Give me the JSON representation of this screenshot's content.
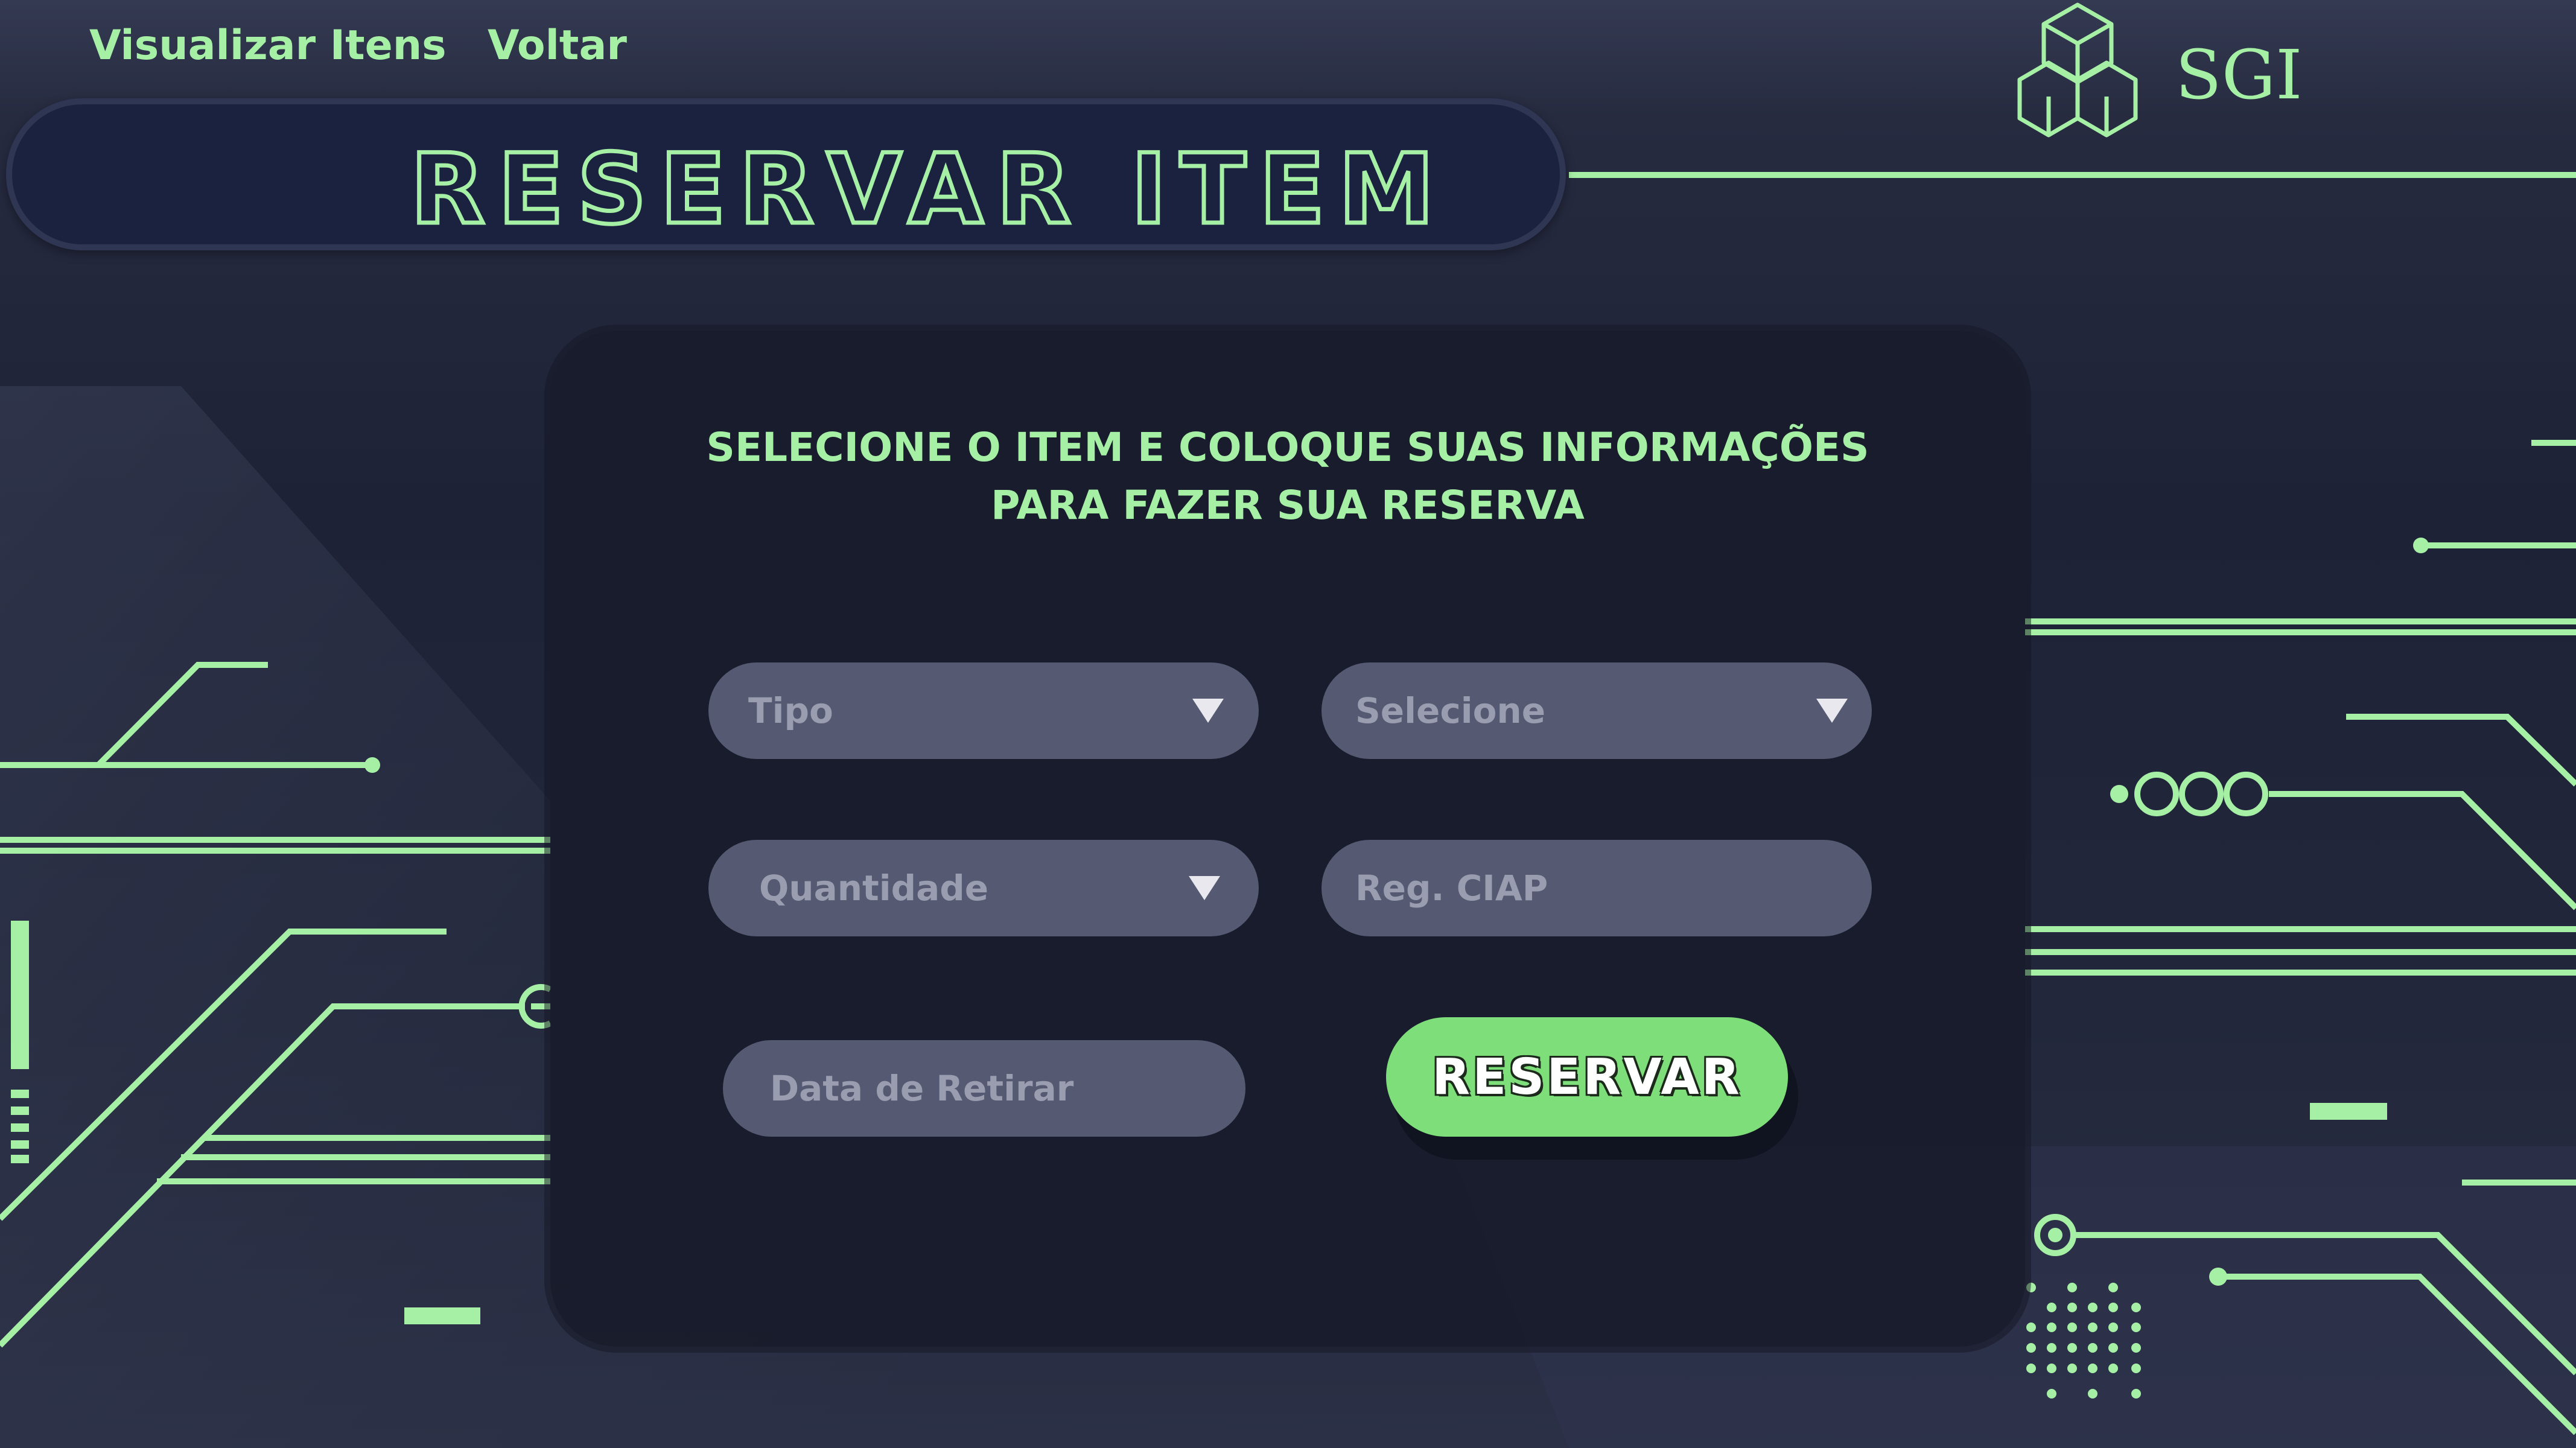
{
  "nav": {
    "view_items": "Visualizar Itens",
    "back": "Voltar"
  },
  "logo": {
    "text": "SGI",
    "icon": "hexagon-cubes-icon"
  },
  "page_title": "RESERVAR ITEM",
  "form": {
    "heading_line1": "SELECIONE O ITEM E COLOQUE SUAS INFORMAÇÕES",
    "heading_line2": "PARA FAZER SUA RESERVA",
    "tipo_select": "Tipo",
    "item_select": "Selecione",
    "quantity_select": "Quantidade",
    "ciap_placeholder": "Reg. CIAP",
    "date_placeholder": "Data de Retirar",
    "submit_label": "RESERVAR"
  },
  "colors": {
    "accent": "#a6f0a6",
    "button": "#7ede7a",
    "background": "#1e2236",
    "field": "#555a72"
  }
}
